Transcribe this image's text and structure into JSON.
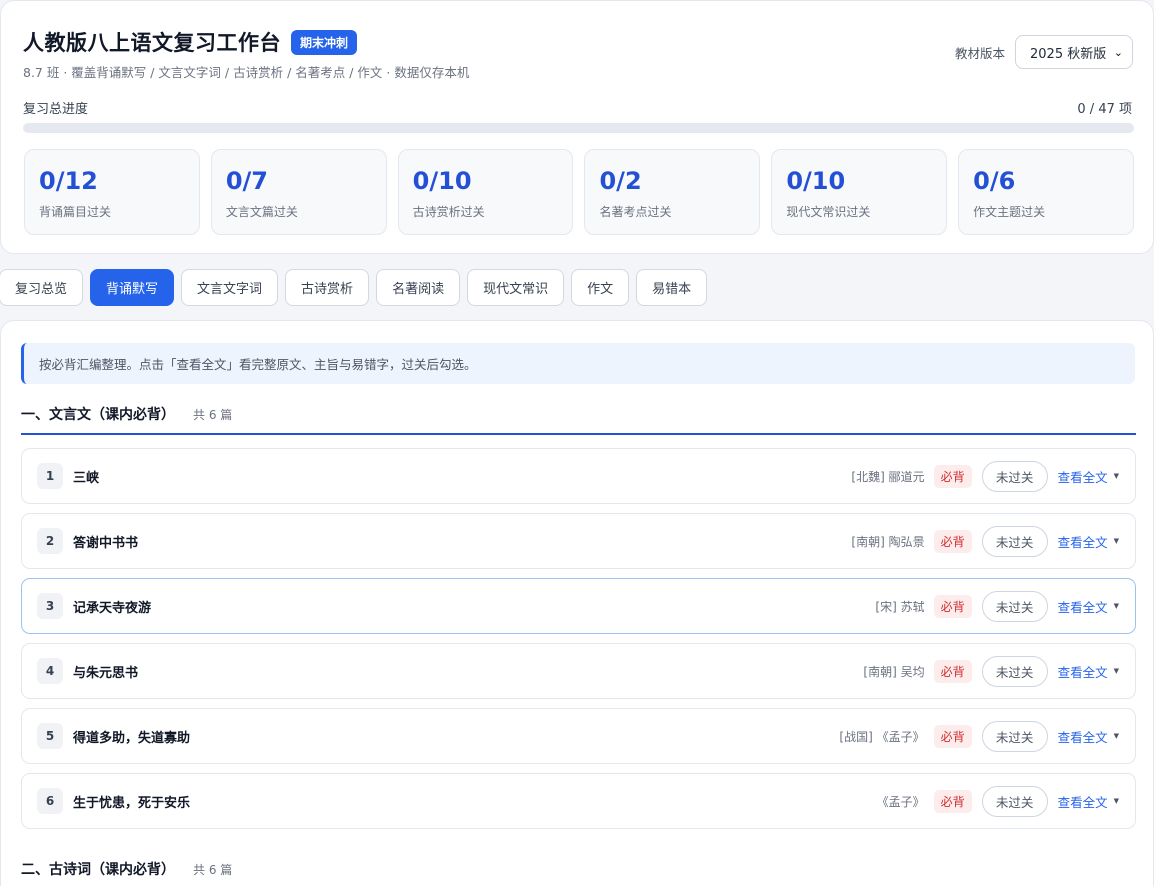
{
  "header": {
    "title": "人教版八上语文复习工作台",
    "badge": "期末冲刺",
    "subtitle": "8.7 班 · 覆盖背诵默写 / 文言文字词 / 古诗赏析 / 名著考点 / 作文 · 数据仅存本机",
    "edition_label": "教材版本",
    "edition_value": "2025 秋新版"
  },
  "progress": {
    "label": "复习总进度",
    "count": "0 / 47 项",
    "fraction": 0
  },
  "stats": [
    {
      "value": "0/12",
      "label": "背诵篇目过关"
    },
    {
      "value": "0/7",
      "label": "文言文篇过关"
    },
    {
      "value": "0/10",
      "label": "古诗赏析过关"
    },
    {
      "value": "0/2",
      "label": "名著考点过关"
    },
    {
      "value": "0/10",
      "label": "现代文常识过关"
    },
    {
      "value": "0/6",
      "label": "作文主题过关"
    }
  ],
  "tabs": [
    "复习总览",
    "背诵默写",
    "文言文字词",
    "古诗赏析",
    "名著阅读",
    "现代文常识",
    "作文",
    "易错本"
  ],
  "active_tab": "背诵默写",
  "tip": "按必背汇编整理。点击「查看全文」看完整原文、主旨与易错字，过关后勾选。",
  "sections": [
    {
      "title": "一、文言文（课内必背）",
      "count": "共 6 篇",
      "items": [
        {
          "num": "1",
          "name": "三峡",
          "author": "[北魏] 郦道元",
          "tag": "必背",
          "status": "未过关",
          "action": "查看全文"
        },
        {
          "num": "2",
          "name": "答谢中书书",
          "author": "[南朝] 陶弘景",
          "tag": "必背",
          "status": "未过关",
          "action": "查看全文"
        },
        {
          "num": "3",
          "name": "记承天寺夜游",
          "author": "[宋] 苏轼",
          "tag": "必背",
          "status": "未过关",
          "action": "查看全文"
        },
        {
          "num": "4",
          "name": "与朱元思书",
          "author": "[南朝] 吴均",
          "tag": "必背",
          "status": "未过关",
          "action": "查看全文"
        },
        {
          "num": "5",
          "name": "得道多助，失道寡助",
          "author": "[战国] 《孟子》",
          "tag": "必背",
          "status": "未过关",
          "action": "查看全文"
        },
        {
          "num": "6",
          "name": "生于忧患，死于安乐",
          "author": "《孟子》",
          "tag": "必背",
          "status": "未过关",
          "action": "查看全文"
        }
      ]
    },
    {
      "title": "二、古诗词（课内必背）",
      "count": "共 6 篇"
    }
  ],
  "colors": {
    "accent": "#2563eb",
    "stat_value": "#2450d6",
    "must_tag_text": "#d12e2e",
    "must_tag_bg": "#fdecec"
  }
}
